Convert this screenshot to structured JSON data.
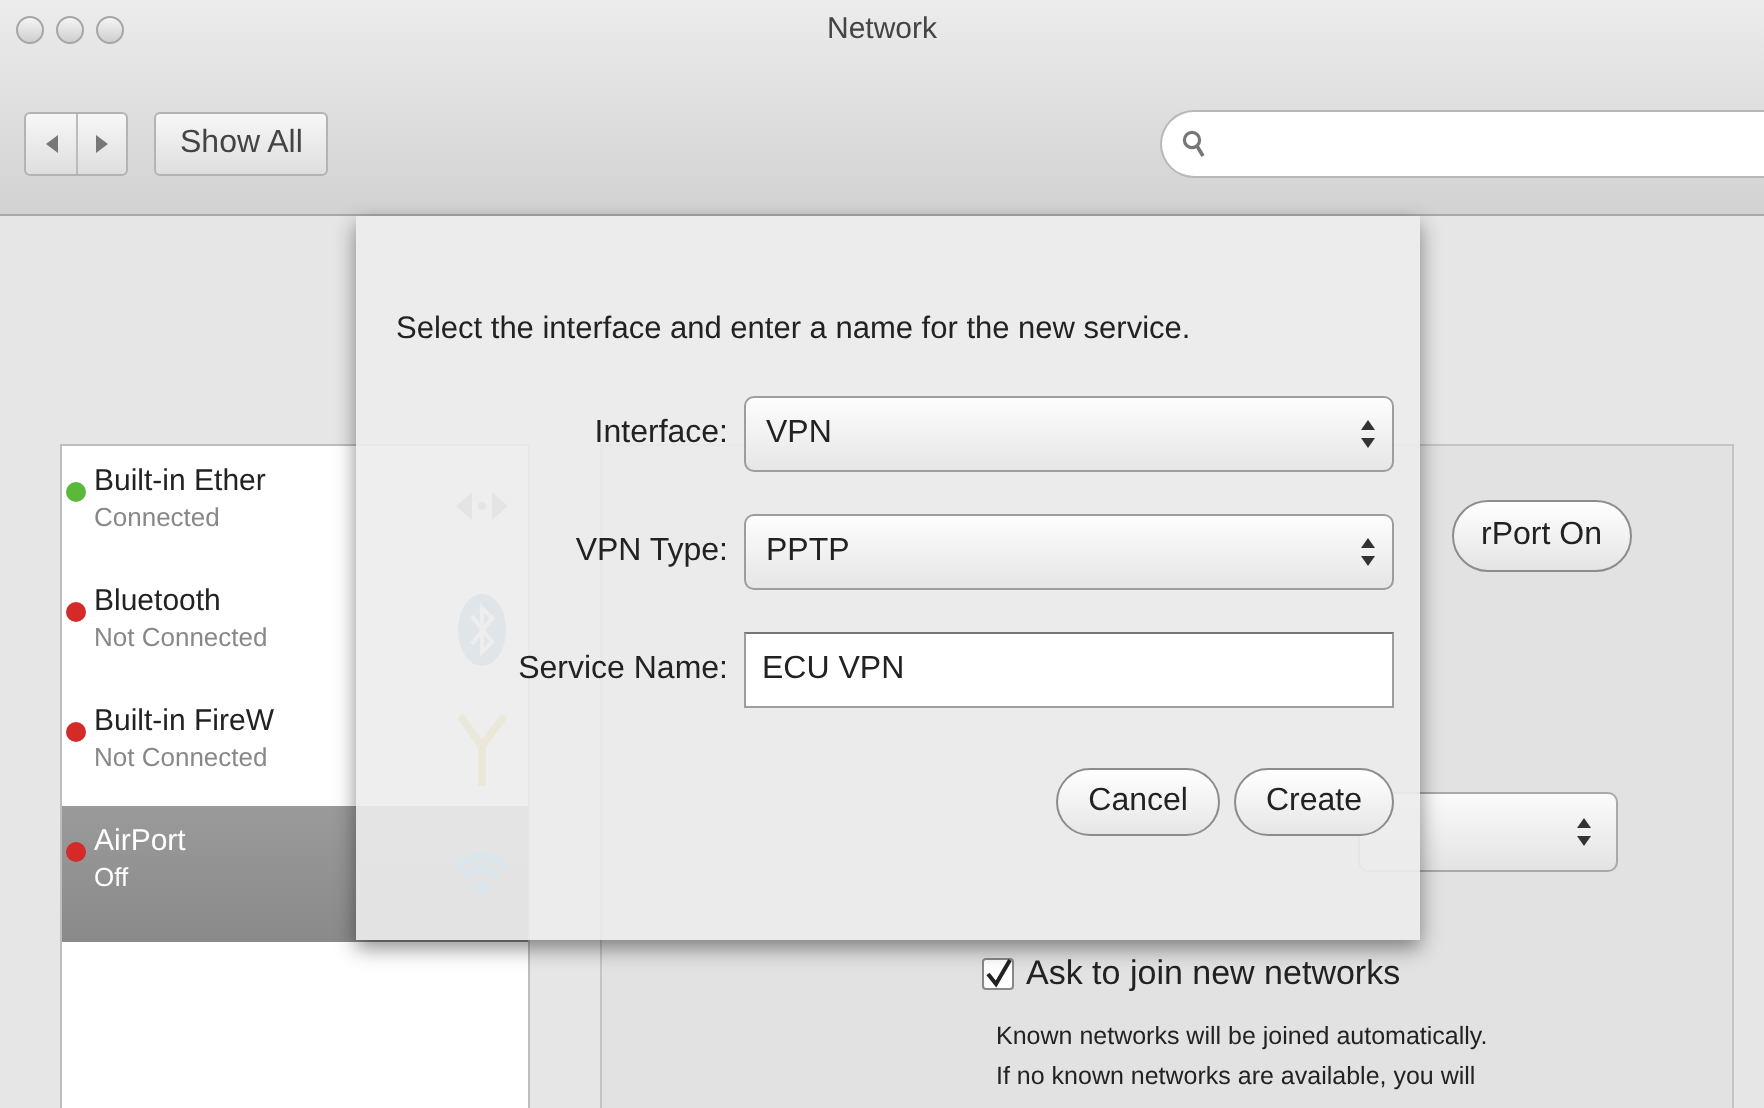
{
  "window": {
    "title": "Network"
  },
  "toolbar": {
    "show_all": "Show All"
  },
  "services": [
    {
      "name": "Built-in Ether",
      "status": "Connected",
      "color": "#5cb83a",
      "selected": false,
      "kind": "ethernet"
    },
    {
      "name": "Bluetooth",
      "status": "Not Connected",
      "color": "#d42a2a",
      "selected": false,
      "kind": "bluetooth"
    },
    {
      "name": "Built-in FireW",
      "status": "Not Connected",
      "color": "#d42a2a",
      "selected": false,
      "kind": "firewire"
    },
    {
      "name": "AirPort",
      "status": "Off",
      "color": "#d42a2a",
      "selected": true,
      "kind": "wifi"
    }
  ],
  "airport_button": "rPort On",
  "ask_to_join": {
    "label": "Ask to join new networks",
    "checked": true
  },
  "help_text": [
    "Known networks will be joined automatically.",
    "If no known networks are available, you will"
  ],
  "dialog": {
    "prompt": "Select the interface and enter a name for the new service.",
    "fields": [
      {
        "kind": "popup",
        "label": "Interface:",
        "value": "VPN"
      },
      {
        "kind": "popup",
        "label": "VPN Type:",
        "value": "PPTP"
      },
      {
        "kind": "text",
        "label": "Service Name:",
        "value": "ECU VPN"
      }
    ],
    "buttons": [
      "Cancel",
      "Create"
    ]
  }
}
